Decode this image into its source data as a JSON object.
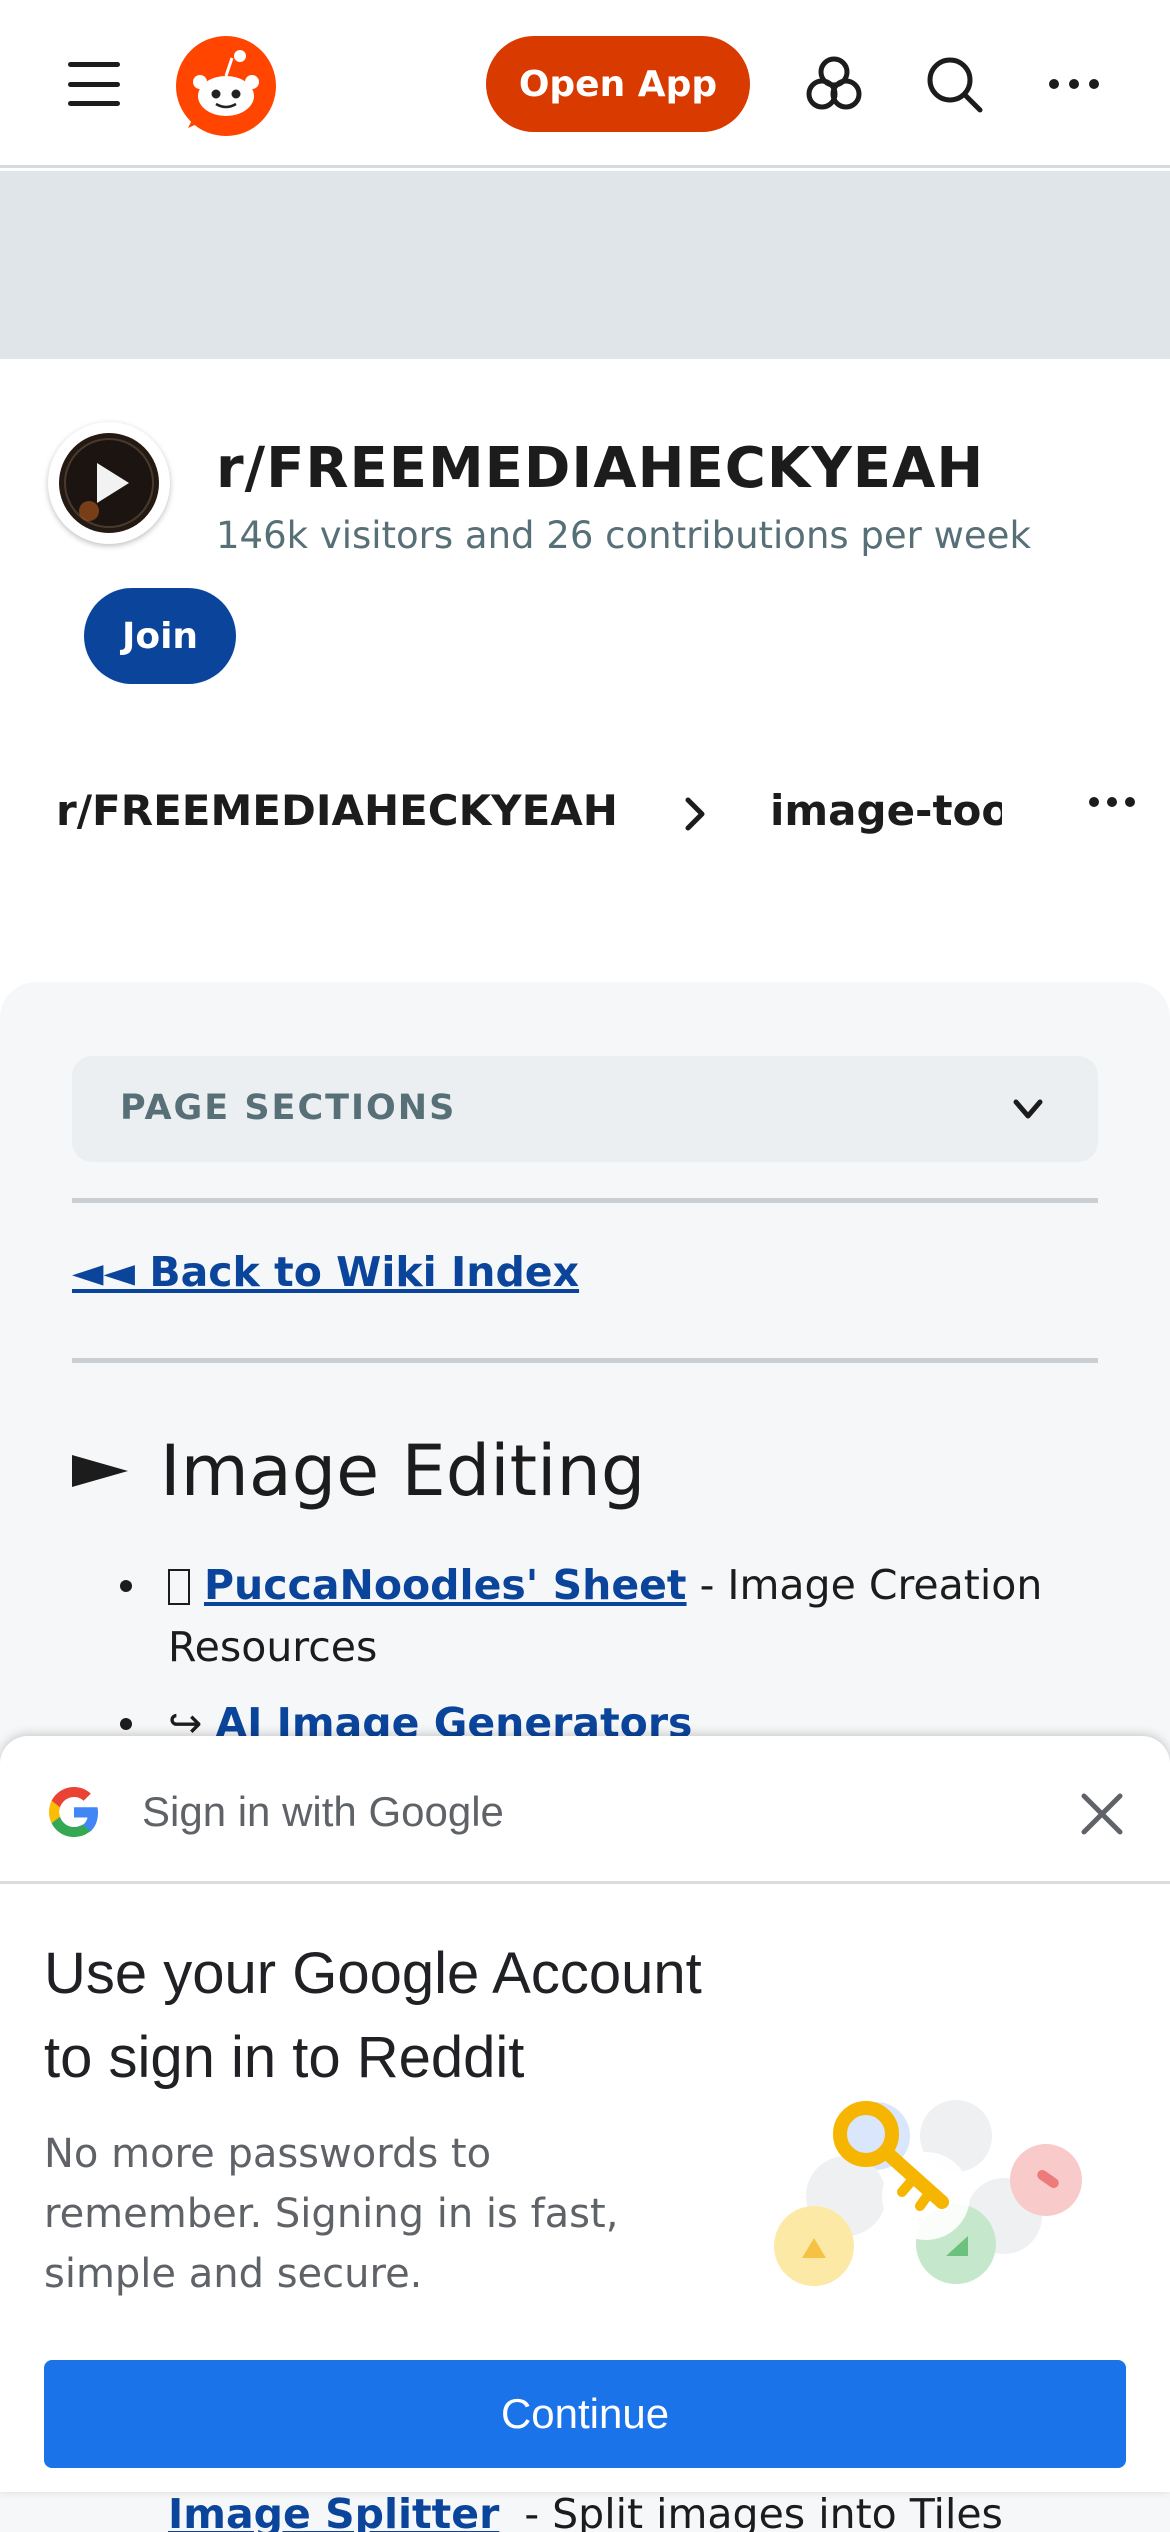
{
  "header": {
    "menu_icon": "hamburger-menu-icon",
    "logo_icon": "reddit-logo-icon",
    "open_app_label": "Open App",
    "popular_icon": "popular-icon",
    "search_icon": "search-icon",
    "more_icon": "more-dots-icon",
    "brand_color": "#d93a00"
  },
  "community": {
    "name": "r/FREEMEDIAHECKYEAH",
    "stats": "146k visitors and 26 contributions per week",
    "join_label": "Join",
    "join_color": "#0a449b"
  },
  "breadcrumb": {
    "subreddit": "r/FREEMEDIAHECKYEAH",
    "page": "image-tools",
    "chevron_icon": "chevron-right-icon",
    "more_icon": "more-dots-icon"
  },
  "wiki": {
    "sections_label": "PAGE SECTIONS",
    "sections_icon": "chevron-down-icon",
    "back_link": "◄◄ Back to Wiki Index",
    "heading": "Image Editing",
    "heading_icon": "triangle-right-icon",
    "items": [
      {
        "link": "PuccaNoodles' Sheet",
        "text": " - Image Creation Resources"
      },
      {
        "prefix": "↪ ",
        "link": "AI Image Generators",
        "text": ""
      }
    ],
    "peek_link": "Image Splitter",
    "peek_text": " - Split images into Tiles"
  },
  "google_signin": {
    "title": "Sign in with Google",
    "close_icon": "close-icon",
    "logo_icon": "google-logo-icon",
    "headline": "Use your Google Account to sign in to Reddit",
    "body": "No more passwords to remember. Signing in is fast, simple and secure.",
    "illustration_icon": "key-illustration-icon",
    "continue_label": "Continue",
    "continue_color": "#1a73e8"
  }
}
